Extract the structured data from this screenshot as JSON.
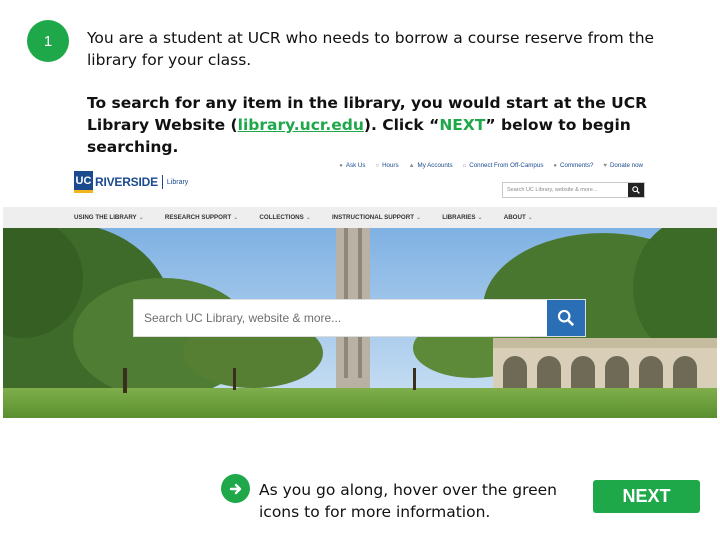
{
  "step": {
    "number": "1"
  },
  "intro": {
    "text": "You are a student at UCR who needs to borrow a course reserve from the library for your class."
  },
  "instruction": {
    "part1": "To search for any item in the library, you would start at the UCR Library Website (",
    "link": "library.ucr.edu",
    "part2": "). Click “",
    "next_word": "NEXT",
    "part3": "” below to begin searching."
  },
  "site": {
    "logo": {
      "uc": "UC",
      "riverside": "RIVERSIDE",
      "library": "Library"
    },
    "utility_links": [
      {
        "icon": "chat-icon",
        "glyph": "●",
        "label": "Ask Us"
      },
      {
        "icon": "clock-icon",
        "glyph": "○",
        "label": "Hours"
      },
      {
        "icon": "user-icon",
        "glyph": "▲",
        "label": "My Accounts"
      },
      {
        "icon": "home-icon",
        "glyph": "⌂",
        "label": "Connect From Off-Campus"
      },
      {
        "icon": "comment-icon",
        "glyph": "●",
        "label": "Comments?"
      },
      {
        "icon": "heart-icon",
        "glyph": "♥",
        "label": "Donate now"
      }
    ],
    "top_search": {
      "placeholder": "Search UC Library, website & more..."
    },
    "nav": [
      {
        "label": "USING THE LIBRARY"
      },
      {
        "label": "RESEARCH SUPPORT"
      },
      {
        "label": "COLLECTIONS"
      },
      {
        "label": "INSTRUCTIONAL SUPPORT"
      },
      {
        "label": "LIBRARIES"
      },
      {
        "label": "ABOUT"
      }
    ],
    "nav_chevron": "⌄",
    "hero_search": {
      "placeholder": "Search UC Library, website & more..."
    }
  },
  "hint": {
    "text": "As you go along, hover over the green icons to for more information."
  },
  "next_button": {
    "label": "NEXT"
  },
  "colors": {
    "accent_green": "#1ea84a",
    "ucr_blue": "#1b4a8f",
    "ucr_gold": "#f2b51c",
    "search_blue": "#2a6fb5"
  }
}
